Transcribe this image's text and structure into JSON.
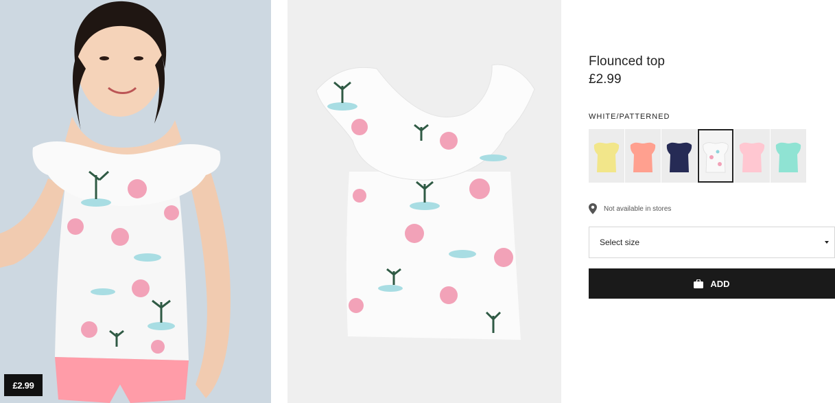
{
  "product": {
    "name": "Flounced top",
    "price": "£2.99",
    "tag_price": "£2.99"
  },
  "color": {
    "selected_label": "WHITE/PATTERNED",
    "swatches": [
      {
        "name": "yellow",
        "hex": "#f2e68a"
      },
      {
        "name": "coral",
        "hex": "#ffa08f"
      },
      {
        "name": "navy",
        "hex": "#262b55"
      },
      {
        "name": "white-patterned",
        "hex": "#f7f7f7"
      },
      {
        "name": "light-pink",
        "hex": "#ffc7d1"
      },
      {
        "name": "mint",
        "hex": "#8fe3d3"
      }
    ]
  },
  "availability": {
    "text": "Not available in stores",
    "icon": "location-pin-icon"
  },
  "size": {
    "placeholder": "Select size",
    "icon": "chevron-down-icon"
  },
  "cart": {
    "add_label": "ADD",
    "icon": "shopping-bag-icon",
    "button_color": "#1a1a1a"
  }
}
